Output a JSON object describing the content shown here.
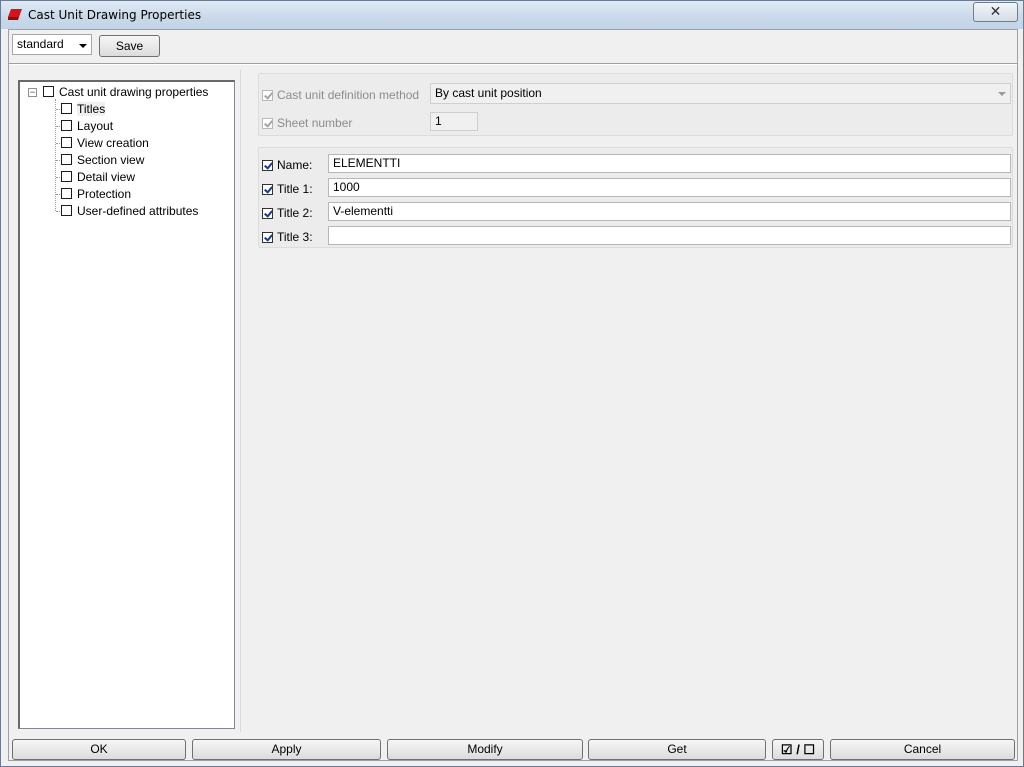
{
  "window": {
    "title": "Cast Unit Drawing Properties",
    "close_glyph": "✕",
    "icon": "tekla-app-icon"
  },
  "toolbar": {
    "preset_value": "standard",
    "save_label": "Save"
  },
  "tree": {
    "root_label": "Cast unit drawing properties",
    "expander_glyph": "−",
    "items": [
      {
        "label": "Titles"
      },
      {
        "label": "Layout"
      },
      {
        "label": "View creation"
      },
      {
        "label": "Section view"
      },
      {
        "label": "Detail view"
      },
      {
        "label": "Protection"
      },
      {
        "label": "User-defined attributes"
      }
    ]
  },
  "general": {
    "definition_method_label": "Cast unit definition method",
    "definition_method_value": "By cast unit position",
    "sheet_number_label": "Sheet number",
    "sheet_number_value": "1"
  },
  "titles": {
    "name_label": "Name:",
    "name_value": "ELEMENTTI",
    "title1_label": "Title 1:",
    "title1_value": "1000",
    "title2_label": "Title 2:",
    "title2_value": "V-elementti",
    "title3_label": "Title 3:",
    "title3_value": ""
  },
  "buttons": {
    "ok": "OK",
    "apply": "Apply",
    "modify": "Modify",
    "get": "Get",
    "toggle": "☑ / ☐",
    "cancel": "Cancel"
  },
  "colors": {
    "titlebar": "#c9d9ea",
    "window_bg": "#f0f0f0",
    "check_mark": "#1a3a8a"
  }
}
